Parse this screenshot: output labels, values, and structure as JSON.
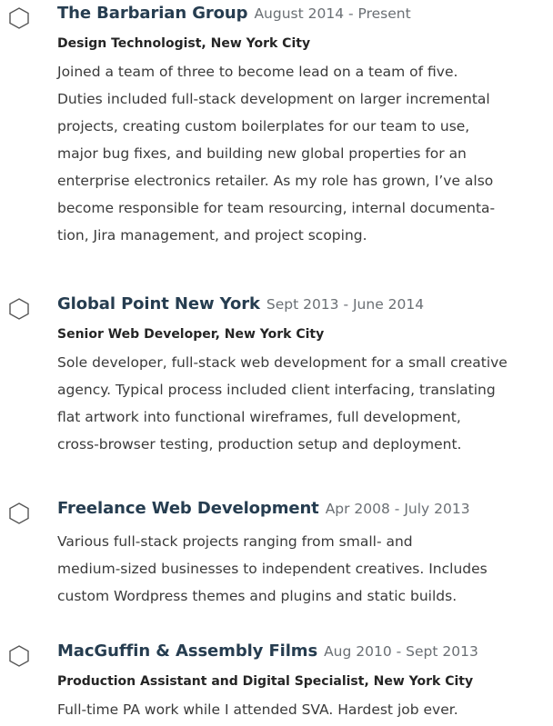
{
  "entries": [
    {
      "company": "The Barbarian Group",
      "dates": "August 2014 - Present",
      "role": "Design Technologist, New York City",
      "lines": [
        "Joined a team of three to become lead on a team of five.",
        "Duties included full-stack development on larger incremental",
        "projects, creating custom boilerplates for our team to use,",
        "major bug fixes, and building new global properties for an",
        "enterprise electronics retailer. As my role has grown, I’ve also",
        "become responsible for team resourcing, internal documenta-",
        "tion, Jira management, and project scoping."
      ]
    },
    {
      "company": "Global Point New York",
      "dates": "Sept 2013 - June 2014",
      "role": "Senior Web Developer, New York City",
      "lines": [
        "Sole developer, full-stack web development for a small creative",
        "agency. Typical process included client interfacing, translating",
        "flat artwork into functional wireframes, full development,",
        "cross-browser testing, production setup and deployment."
      ]
    },
    {
      "company": "Freelance Web Development",
      "dates": "Apr 2008 - July 2013",
      "role": "",
      "lines": [
        "Various full-stack projects ranging from small- and",
        "medium-sized businesses to independent creatives. Includes",
        "custom Wordpress themes and plugins and static builds."
      ]
    },
    {
      "company": "MacGuffin & Assembly Films",
      "dates": "Aug 2010 - Sept 2013",
      "role": "Production Assistant and Digital Specialist, New York City",
      "lines": [
        "Full-time PA work while I attended SVA. Hardest job ever."
      ]
    }
  ],
  "colors": {
    "company": "#263d50",
    "dates": "#6a6f74",
    "text": "#3a3a3a",
    "marker": "#555555"
  },
  "icons": {
    "marker": "hexagon-icon"
  }
}
